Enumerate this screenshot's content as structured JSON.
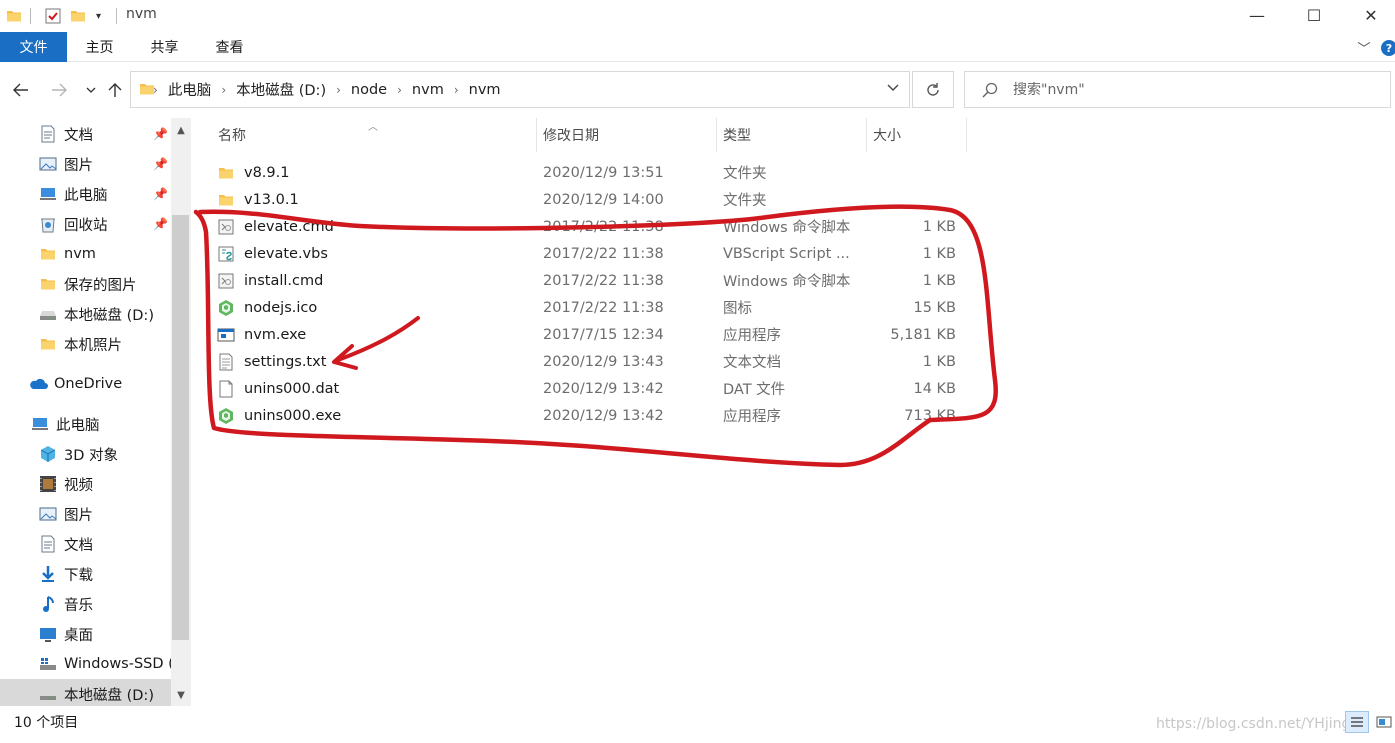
{
  "window": {
    "title": "nvm",
    "controls": {
      "minimize": "—",
      "maximize": "☐",
      "close": "✕"
    }
  },
  "ribbon": {
    "tabs": [
      "文件",
      "主页",
      "共享",
      "查看"
    ],
    "help": "?"
  },
  "address": {
    "crumbs": [
      "此电脑",
      "本地磁盘 (D:)",
      "node",
      "nvm",
      "nvm"
    ],
    "search_placeholder": "搜索\"nvm\""
  },
  "nav": {
    "quick_access": [
      {
        "label": "文档",
        "icon": "document-icon",
        "pinned": true
      },
      {
        "label": "图片",
        "icon": "pictures-icon",
        "pinned": true
      },
      {
        "label": "此电脑",
        "icon": "computer-icon",
        "pinned": true
      },
      {
        "label": "回收站",
        "icon": "recycle-bin-icon",
        "pinned": true
      },
      {
        "label": "nvm",
        "icon": "folder-icon",
        "pinned": false
      },
      {
        "label": "保存的图片",
        "icon": "folder-icon",
        "pinned": false
      },
      {
        "label": "本地磁盘 (D:)",
        "icon": "drive-icon",
        "pinned": false
      },
      {
        "label": "本机照片",
        "icon": "folder-icon",
        "pinned": false
      }
    ],
    "onedrive": "OneDrive",
    "this_pc": "此电脑",
    "pc_items": [
      {
        "label": "3D 对象",
        "icon": "3d-objects-icon"
      },
      {
        "label": "视频",
        "icon": "video-icon"
      },
      {
        "label": "图片",
        "icon": "pictures-icon"
      },
      {
        "label": "文档",
        "icon": "document-icon"
      },
      {
        "label": "下载",
        "icon": "download-icon"
      },
      {
        "label": "音乐",
        "icon": "music-icon"
      },
      {
        "label": "桌面",
        "icon": "desktop-icon"
      },
      {
        "label": "Windows-SSD (",
        "icon": "windows-drive-icon"
      },
      {
        "label": "本地磁盘 (D:)",
        "icon": "drive-icon",
        "selected": true
      }
    ]
  },
  "columns": {
    "name": "名称",
    "date": "修改日期",
    "type": "类型",
    "size": "大小"
  },
  "files": [
    {
      "name": "v8.9.1",
      "date": "2020/12/9 13:51",
      "type": "文件夹",
      "size": "",
      "icon": "folder-icon"
    },
    {
      "name": "v13.0.1",
      "date": "2020/12/9 14:00",
      "type": "文件夹",
      "size": "",
      "icon": "folder-icon"
    },
    {
      "name": "elevate.cmd",
      "date": "2017/2/22 11:38",
      "type": "Windows 命令脚本",
      "size": "1 KB",
      "icon": "cmd-script-icon"
    },
    {
      "name": "elevate.vbs",
      "date": "2017/2/22 11:38",
      "type": "VBScript Script ...",
      "size": "1 KB",
      "icon": "vbs-script-icon"
    },
    {
      "name": "install.cmd",
      "date": "2017/2/22 11:38",
      "type": "Windows 命令脚本",
      "size": "1 KB",
      "icon": "cmd-script-icon"
    },
    {
      "name": "nodejs.ico",
      "date": "2017/2/22 11:38",
      "type": "图标",
      "size": "15 KB",
      "icon": "nodejs-icon"
    },
    {
      "name": "nvm.exe",
      "date": "2017/7/15 12:34",
      "type": "应用程序",
      "size": "5,181 KB",
      "icon": "exe-icon"
    },
    {
      "name": "settings.txt",
      "date": "2020/12/9 13:43",
      "type": "文本文档",
      "size": "1 KB",
      "icon": "text-file-icon"
    },
    {
      "name": "unins000.dat",
      "date": "2020/12/9 13:42",
      "type": "DAT 文件",
      "size": "14 KB",
      "icon": "blank-file-icon"
    },
    {
      "name": "unins000.exe",
      "date": "2020/12/9 13:42",
      "type": "应用程序",
      "size": "713 KB",
      "icon": "nodejs-icon"
    }
  ],
  "status": {
    "count": "10 个项目",
    "watermark": "https://blog.csdn.net/YHjingYu"
  },
  "colors": {
    "accent": "#1a6fc4",
    "annotation": "#d0191f",
    "folder": "#f5c04a"
  }
}
